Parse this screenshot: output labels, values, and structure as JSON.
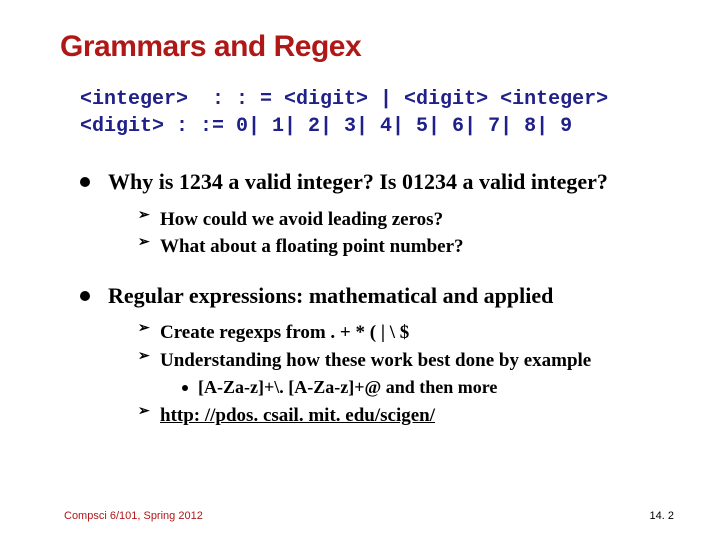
{
  "title": "Grammars and Regex",
  "grammar": {
    "line1": "<integer>  : : = <digit> | <digit> <integer>",
    "line2": "<digit> : := 0| 1| 2| 3| 4| 5| 6| 7| 8| 9"
  },
  "bullets": [
    {
      "text": "Why is 1234 a valid integer? Is 01234 a valid integer?",
      "subs": [
        {
          "text": "How could we avoid leading zeros?"
        },
        {
          "text": "What about a floating point number?"
        }
      ]
    },
    {
      "text": "Regular expressions: mathematical and applied",
      "subs": [
        {
          "text": "Create regexps from . + * ( | \\ $"
        },
        {
          "text": "Understanding how these work best done by example",
          "subsubs": [
            {
              "text": "[A-Za-z]+\\. [A-Za-z]+@ and then more"
            }
          ]
        },
        {
          "text": "http: //pdos. csail. mit. edu/scigen/",
          "link": true
        }
      ]
    }
  ],
  "footer": {
    "left": "Compsci 6/101, Spring 2012",
    "right": "14. 2"
  }
}
